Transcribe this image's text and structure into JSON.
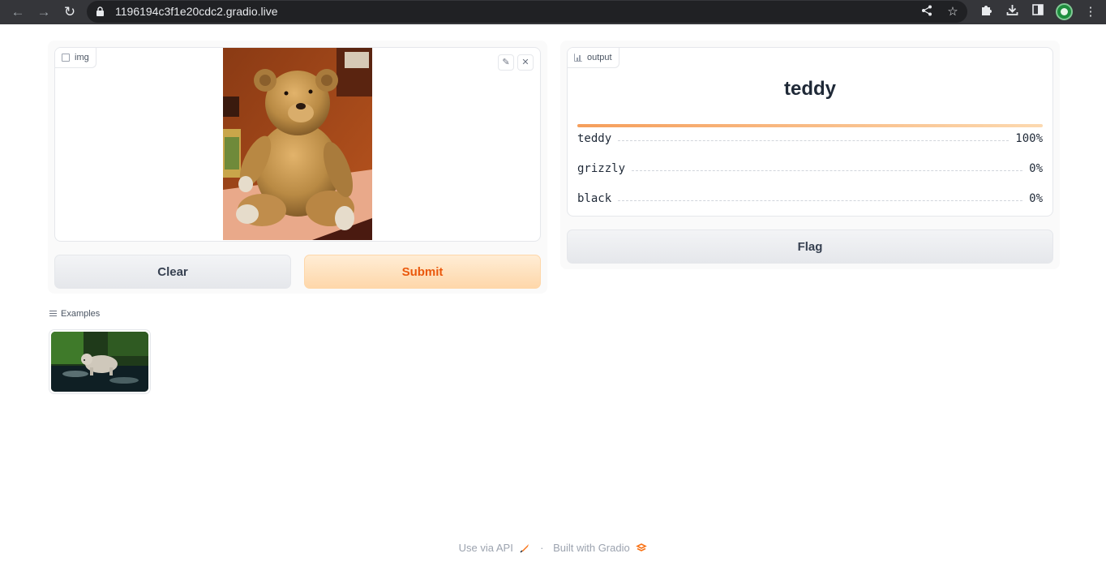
{
  "browser": {
    "url": "1196194c3f1e20cdc2.gradio.live"
  },
  "input_panel": {
    "image_label": "img",
    "clear_label": "Clear",
    "submit_label": "Submit"
  },
  "output_panel": {
    "label": "output",
    "top_label": "teddy",
    "confidences": [
      {
        "label": "teddy",
        "value": "100%"
      },
      {
        "label": "grizzly",
        "value": "0%"
      },
      {
        "label": "black",
        "value": "0%"
      }
    ],
    "flag_label": "Flag"
  },
  "examples": {
    "label": "Examples"
  },
  "footer": {
    "api_link": "Use via API",
    "separator": "·",
    "built_with": "Built with Gradio"
  },
  "colors": {
    "accent": "#ea580c",
    "primary_bg": "#fed7aa",
    "chrome_bg": "#35363a"
  }
}
